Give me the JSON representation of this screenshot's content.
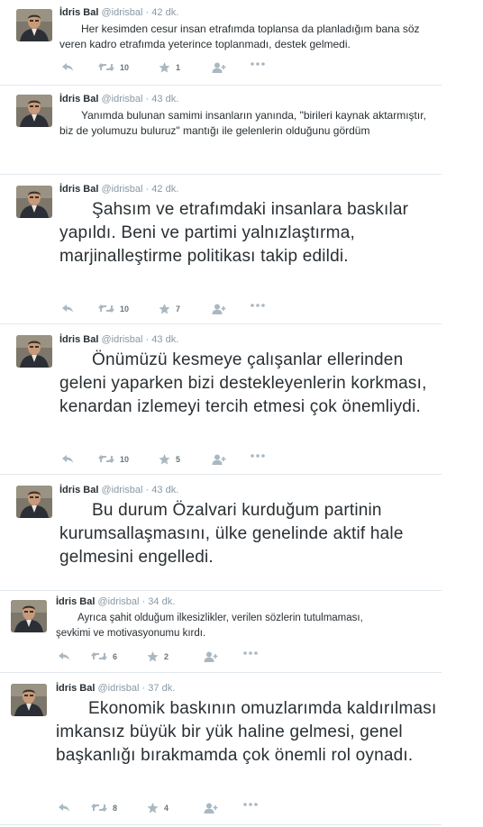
{
  "colors": {
    "name": "#292f33",
    "muted": "#8899a6",
    "icon": "#aab8c2",
    "border": "#e1e8ed"
  },
  "icons": {
    "reply": "reply-icon",
    "retweet": "retweet-icon",
    "favorite": "star-icon",
    "follow": "follow-icon",
    "more": "more-dots-icon"
  },
  "tweets": [
    {
      "name": "İdris Bal",
      "handle": "@idrisbal",
      "time": "42 dk.",
      "text": "Her kesimden cesur insan etrafımda toplansa da planladığım bana söz veren kadro etrafımda yeterince toplanmadı, destek gelmedi.",
      "retweets": "10",
      "favorites": "1"
    },
    {
      "name": "İdris Bal",
      "handle": "@idrisbal",
      "time": "43 dk.",
      "text": "Yanımda bulunan samimi insanların yanında, \"birileri kaynak aktarmıştır, biz de yolumuzu buluruz\" mantığı ile gelenlerin olduğunu gördüm"
    },
    {
      "name": "İdris Bal",
      "handle": "@idrisbal",
      "time": "42 dk.",
      "text": "Şahsım ve etrafımdaki insanlara baskılar yapıldı. Beni ve partimi yalnızlaştırma, marjinalleştirme politikası takip edildi.",
      "retweets": "10",
      "favorites": "7"
    },
    {
      "name": "İdris Bal",
      "handle": "@idrisbal",
      "time": "43 dk.",
      "text": "Önümüzü kesmeye çalışanlar ellerinden geleni yaparken bizi destekleyenlerin korkması, kenardan izlemeyi tercih etmesi çok önemliydi.",
      "retweets": "10",
      "favorites": "5"
    },
    {
      "name": "İdris Bal",
      "handle": "@idrisbal",
      "time": "43 dk.",
      "text": "Bu durum Özalvari kurduğum partinin kurumsallaşmasını, ülke genelinde aktif hale gelmesini engelledi."
    },
    {
      "name": "İdris Bal",
      "handle": "@idrisbal",
      "time": "34 dk.",
      "text": "Ayrıca şahit olduğum ilkesizlikler, verilen sözlerin tutulmaması, şevkimi ve motivasyonumu kırdı.",
      "retweets": "6",
      "favorites": "2"
    },
    {
      "name": "İdris Bal",
      "handle": "@idrisbal",
      "time": "37 dk.",
      "text": "Ekonomik baskının omuzlarımda kaldırılması imkansız büyük bir yük haline gelmesi, genel başkanlığı bırakmamda çok önemli rol oynadı.",
      "retweets": "8",
      "favorites": "4"
    }
  ]
}
